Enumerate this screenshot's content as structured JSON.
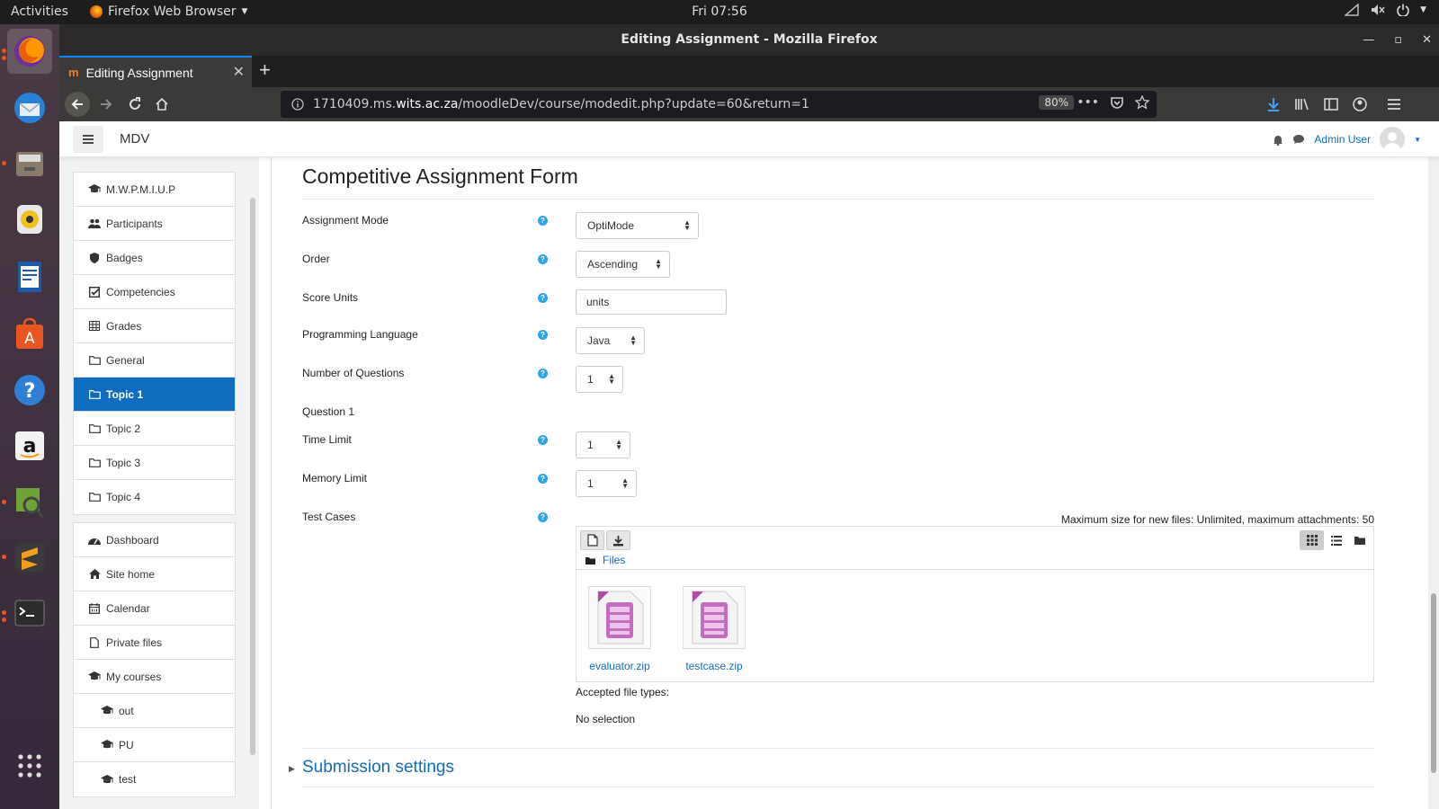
{
  "system": {
    "activities": "Activities",
    "app_menu": "Firefox Web Browser",
    "clock": "Fri 07:56"
  },
  "window": {
    "title": "Editing Assignment - Mozilla Firefox",
    "tab_title": "Editing Assignment",
    "url_prefix": "1710409.ms.",
    "url_host": "wits.ac.za",
    "url_path": "/moodleDev/course/modedit.php?update=60&return=1",
    "zoom": "80%"
  },
  "moodle": {
    "site_name": "MDV",
    "user_name": "Admin User"
  },
  "nav": {
    "course_items": [
      {
        "label": "M.W.P.M.I.U.P",
        "icon": "graduation-cap-icon"
      },
      {
        "label": "Participants",
        "icon": "users-icon"
      },
      {
        "label": "Badges",
        "icon": "shield-icon"
      },
      {
        "label": "Competencies",
        "icon": "check-square-icon"
      },
      {
        "label": "Grades",
        "icon": "table-icon"
      },
      {
        "label": "General",
        "icon": "folder-icon"
      },
      {
        "label": "Topic 1",
        "icon": "folder-icon"
      },
      {
        "label": "Topic 2",
        "icon": "folder-icon"
      },
      {
        "label": "Topic 3",
        "icon": "folder-icon"
      },
      {
        "label": "Topic 4",
        "icon": "folder-icon"
      }
    ],
    "site_items": [
      {
        "label": "Dashboard",
        "icon": "dashboard-icon"
      },
      {
        "label": "Site home",
        "icon": "home-icon"
      },
      {
        "label": "Calendar",
        "icon": "calendar-icon"
      },
      {
        "label": "Private files",
        "icon": "file-icon"
      },
      {
        "label": "My courses",
        "icon": "graduation-cap-icon"
      },
      {
        "label": "out",
        "icon": "graduation-cap-icon"
      },
      {
        "label": "PU",
        "icon": "graduation-cap-icon"
      },
      {
        "label": "test",
        "icon": "graduation-cap-icon"
      }
    ],
    "active": "Topic 1"
  },
  "form": {
    "title": "Competitive Assignment Form",
    "assignment_mode": {
      "label": "Assignment Mode",
      "value": "OptiMode"
    },
    "order": {
      "label": "Order",
      "value": "Ascending"
    },
    "score_units": {
      "label": "Score Units",
      "value": "units"
    },
    "programming_language": {
      "label": "Programming Language",
      "value": "Java"
    },
    "num_questions": {
      "label": "Number of Questions",
      "value": "1"
    },
    "question_heading": "Question 1",
    "time_limit": {
      "label": "Time Limit",
      "value": "1"
    },
    "memory_limit": {
      "label": "Memory Limit",
      "value": "1"
    },
    "test_cases": {
      "label": "Test Cases",
      "max_size": "Maximum size for new files: Unlimited, maximum attachments: 50",
      "path": "Files",
      "files": [
        "evaluator.zip",
        "testcase.zip"
      ]
    },
    "accepted_types": "Accepted file types:",
    "no_selection": "No selection",
    "submission_settings": "Submission settings"
  },
  "colors": {
    "accent": "#0f6cbf",
    "help": "#2fa4e7",
    "ubuntu_orange": "#e95420"
  }
}
